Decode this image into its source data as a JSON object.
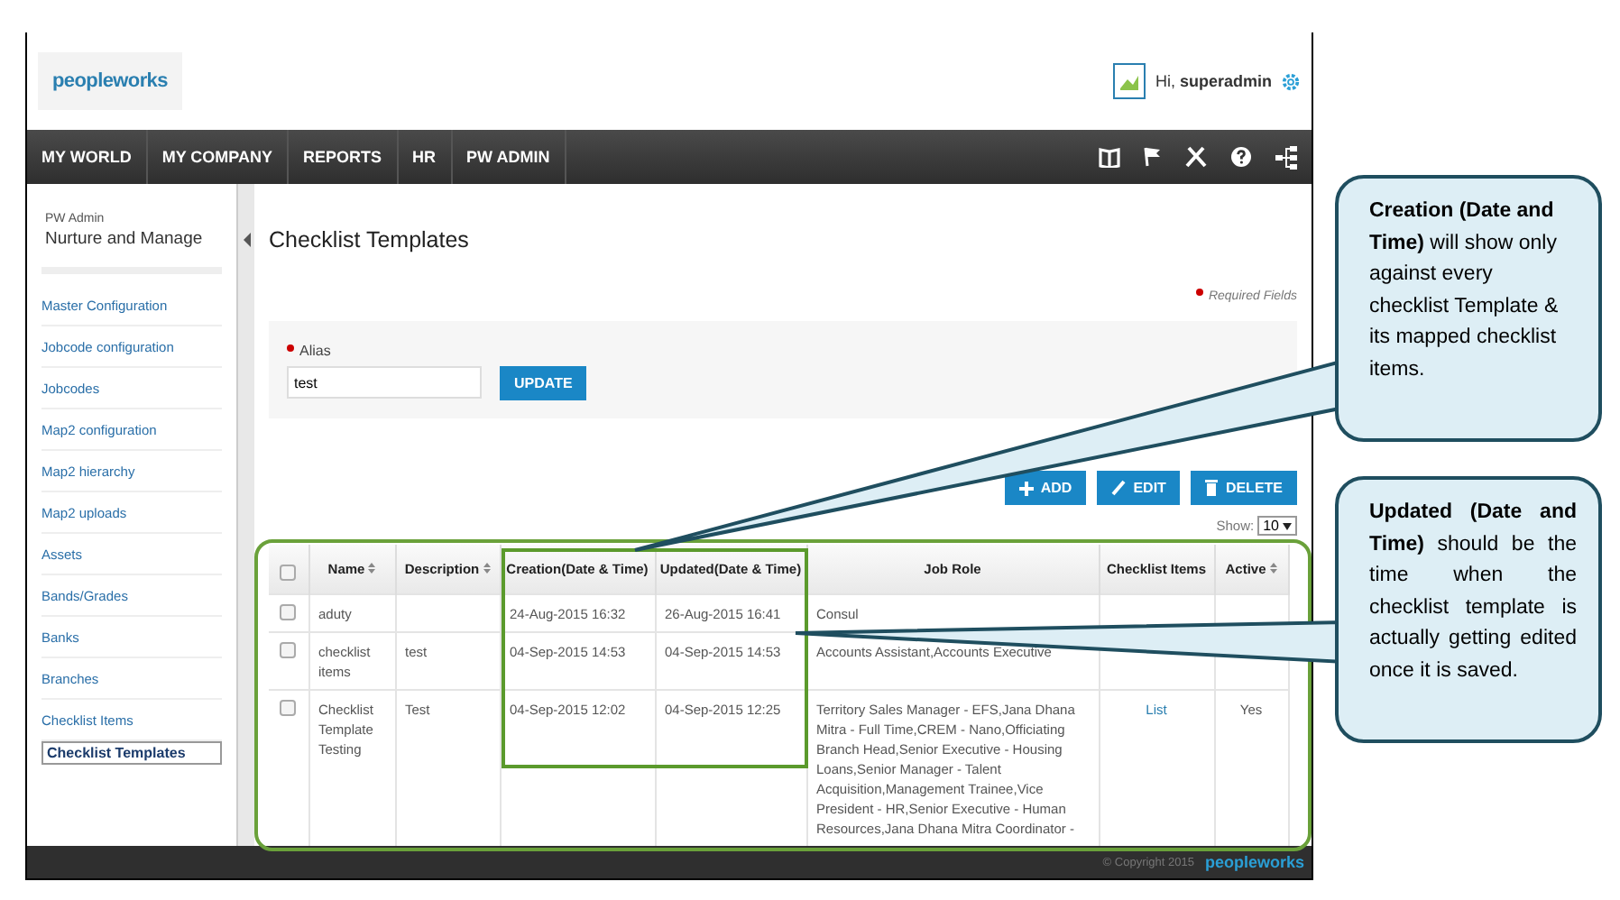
{
  "header": {
    "logo": "peopleworks",
    "greeting": "Hi, **superadmin**"
  },
  "nav": {
    "items": [
      "MY WORLD",
      "MY COMPANY",
      "REPORTS",
      "HR",
      "PW ADMIN"
    ]
  },
  "sidebar": {
    "caption": "PW Admin",
    "title": "Nurture and Manage",
    "items": [
      {
        "label": "Master Configuration",
        "selected": false
      },
      {
        "label": "Jobcode configuration",
        "selected": false
      },
      {
        "label": "Jobcodes",
        "selected": false
      },
      {
        "label": "Map2 configuration",
        "selected": false
      },
      {
        "label": "Map2 hierarchy",
        "selected": false
      },
      {
        "label": "Map2 uploads",
        "selected": false
      },
      {
        "label": "Assets",
        "selected": false
      },
      {
        "label": "Bands/Grades",
        "selected": false
      },
      {
        "label": "Banks",
        "selected": false
      },
      {
        "label": "Branches",
        "selected": false
      },
      {
        "label": "Checklist Items",
        "selected": false
      },
      {
        "label": "Checklist Templates",
        "selected": true
      }
    ]
  },
  "page": {
    "title": "Checklist Templates",
    "required_note": "Required Fields",
    "alias_label": "Alias",
    "alias_value": "test",
    "update_button": "UPDATE",
    "actions": [
      {
        "kind": "add",
        "label": "ADD"
      },
      {
        "kind": "edit",
        "label": "EDIT"
      },
      {
        "kind": "delete",
        "label": "DELETE"
      }
    ],
    "show_label": "Show:",
    "show_value": "10"
  },
  "table": {
    "select_all_checked": false,
    "columns": [
      {
        "label": "Name",
        "sortable": true
      },
      {
        "label": "Description",
        "sortable": true
      },
      {
        "label": "Creation(Date & Time)",
        "sortable": false
      },
      {
        "label": "Updated(Date & Time)",
        "sortable": false
      },
      {
        "label": "Job Role",
        "sortable": false
      },
      {
        "label": "Checklist Items",
        "sortable": false
      },
      {
        "label": "Active",
        "sortable": true
      }
    ],
    "rows": [
      {
        "checked": false,
        "cells": [
          "aduty",
          "",
          "24-Aug-2015 16:32",
          "26-Aug-2015 16:41",
          "Consul",
          "",
          ""
        ]
      },
      {
        "checked": false,
        "cells": [
          "checklist items",
          "test",
          "04-Sep-2015 14:53",
          "04-Sep-2015 14:53",
          "Accounts Assistant,Accounts Executive",
          "",
          ""
        ]
      },
      {
        "checked": false,
        "cells": [
          "Checklist Template Testing",
          "Test",
          "04-Sep-2015 12:02",
          "04-Sep-2015 12:25",
          "Territory Sales Manager - EFS,Jana Dhana Mitra - Full Time,CREM - Nano,Officiating Branch Head,Senior Executive - Housing Loans,Senior Manager - Talent Acquisition,Management Trainee,Vice President - HR,Senior Executive - Human Resources,Jana Dhana Mitra Coordinator -",
          "List",
          "Yes"
        ]
      }
    ]
  },
  "footer": {
    "copyright": "© Copyright 2015",
    "logo": "peopleworks"
  },
  "callouts": [
    {
      "text": "**Creation (Date and Time)** will show only against every checklist Template & its mapped checklist items.",
      "justified": false
    },
    {
      "text": "**Updated (Date and Time)** should be the time when the checklist template is actually getting edited once it is saved.",
      "justified": true
    }
  ]
}
